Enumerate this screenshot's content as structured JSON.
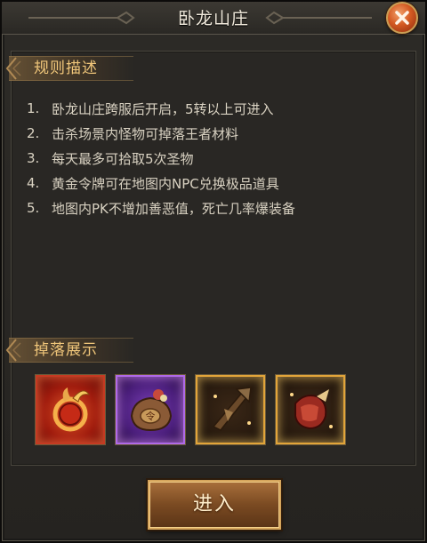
{
  "window": {
    "title": "卧龙山庄"
  },
  "rules_section": {
    "heading": "规则描述"
  },
  "rules": [
    {
      "num": "1.",
      "text": "卧龙山庄跨服后开启，5转以上可进入"
    },
    {
      "num": "2.",
      "text": "击杀场景内怪物可掉落王者材料"
    },
    {
      "num": "3.",
      "text": "每天最多可拾取5次圣物"
    },
    {
      "num": "4.",
      "text": "黄金令牌可在地图内NPC兑换极品道具"
    },
    {
      "num": "5.",
      "text": "地图内PK不增加善恶值，死亡几率爆装备"
    }
  ],
  "drops_section": {
    "heading": "掉落展示"
  },
  "drops": [
    {
      "icon": "dragon-ring-icon",
      "rarity_color": "#c53a22"
    },
    {
      "icon": "token-pouch-icon",
      "rarity_color": "#b06ae8"
    },
    {
      "icon": "weapon-fragment-icon",
      "rarity_color": "#e2a53a"
    },
    {
      "icon": "armor-fragment-icon",
      "rarity_color": "#e2a53a"
    }
  ],
  "enter_button": {
    "label": "进入"
  },
  "colors": {
    "heading": "#f0c67a",
    "text": "#d9d2c2",
    "accent": "#d45a22"
  }
}
